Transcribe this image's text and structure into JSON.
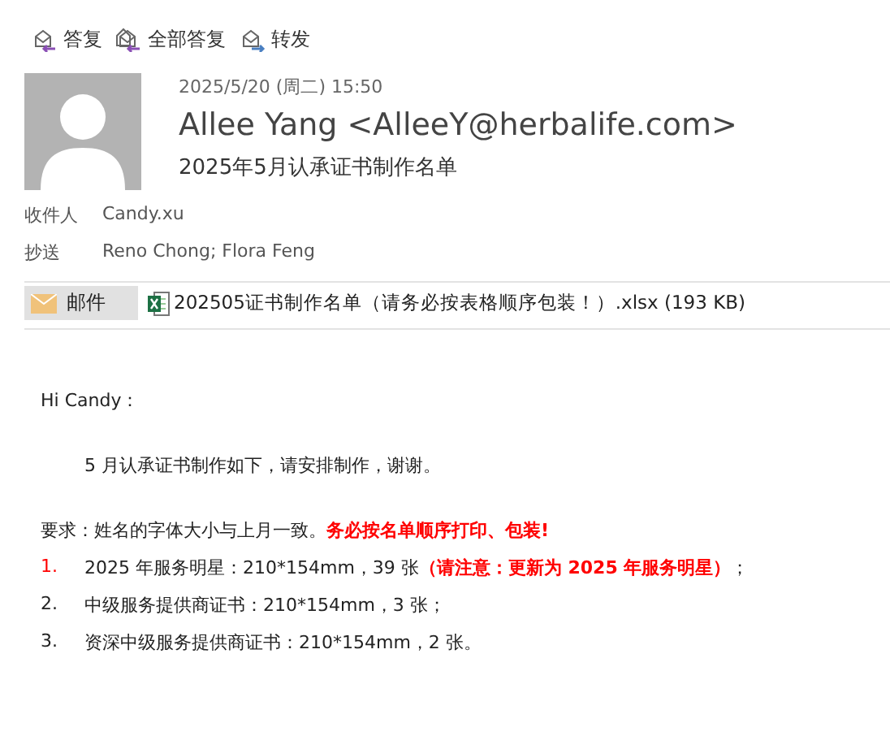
{
  "toolbar": [
    {
      "kind": "reply",
      "label": "答复"
    },
    {
      "kind": "reply_all",
      "label": "全部答复"
    },
    {
      "kind": "forward",
      "label": "转发"
    }
  ],
  "header": {
    "date": "2025/5/20 (周二) 15:50",
    "sender": "Allee Yang <AlleeY@herbalife.com>",
    "subject": "2025年5月认承证书制作名单",
    "fields": [
      {
        "label": "收件人",
        "value": "Candy.xu"
      },
      {
        "label": "抄送",
        "value": "Reno Chong; Flora Feng"
      }
    ]
  },
  "attachments": {
    "message_tab": {
      "label": "邮件",
      "selected": true
    },
    "file": "202505证书制作名单（请务必按表格顺序包装！）.xlsx (193 KB)"
  },
  "body": {
    "greeting": "Hi Candy：",
    "intro": "5 月认承证书制作如下，请安排制作，谢谢。",
    "requirement": [
      {
        "kind": "plain",
        "text": "要求：姓名的字体大小与上月一致。"
      },
      {
        "kind": "emphasis",
        "text": "务必按名单顺序打印、包装!"
      }
    ],
    "items": [
      {
        "number": "1.",
        "color": "#ff0000",
        "parts": [
          {
            "kind": "plain",
            "text": "2025 年服务明星：210*154mm，39 张"
          },
          {
            "kind": "emphasis",
            "text": "（请注意：更新为 2025 年服务明星）"
          },
          {
            "kind": "plain",
            "text": "；"
          }
        ]
      },
      {
        "number": "2.",
        "color": "#222222",
        "parts": [
          {
            "kind": "plain",
            "text": "中级服务提供商证书：210*154mm，3 张；"
          }
        ]
      },
      {
        "number": "3.",
        "color": "#222222",
        "parts": [
          {
            "kind": "plain",
            "text": "资深中级服务提供商证书：210*154mm，2 张。"
          }
        ]
      }
    ]
  }
}
